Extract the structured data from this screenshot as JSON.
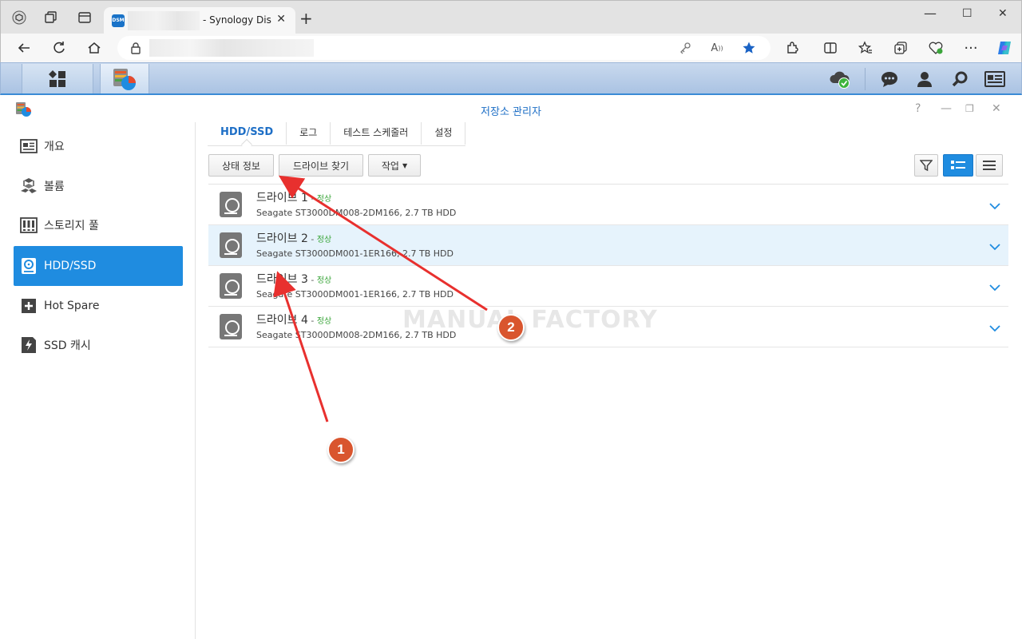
{
  "browser": {
    "tab_title": "- Synology DiskS",
    "tab_favicon": "DSM",
    "colors": {
      "accent": "#1f8ce0"
    }
  },
  "app": {
    "title": "저장소 관리자"
  },
  "sidebar": {
    "items": [
      {
        "label": "개요",
        "icon": "overview-icon"
      },
      {
        "label": "볼륨",
        "icon": "volume-icon"
      },
      {
        "label": "스토리지 풀",
        "icon": "storage-pool-icon"
      },
      {
        "label": "HDD/SSD",
        "icon": "hdd-icon",
        "active": true
      },
      {
        "label": "Hot Spare",
        "icon": "hot-spare-icon"
      },
      {
        "label": "SSD 캐시",
        "icon": "ssd-cache-icon"
      }
    ]
  },
  "tabs": [
    "HDD/SSD",
    "로그",
    "테스트 스케줄러",
    "설정"
  ],
  "toolbar": {
    "status_info": "상태 정보",
    "find_drive": "드라이브 찾기",
    "action": "작업"
  },
  "drives": [
    {
      "name": "드라이브 1",
      "sep": " - ",
      "status": "정상",
      "desc": "Seagate ST3000DM008-2DM166, 2.7 TB HDD"
    },
    {
      "name": "드라이브 2",
      "sep": " - ",
      "status": "정상",
      "desc": "Seagate ST3000DM001-1ER166, 2.7 TB HDD"
    },
    {
      "name": "드라이브 3",
      "sep": " - ",
      "status": "정상",
      "desc": "Seagate ST3000DM001-1ER166, 2.7 TB HDD"
    },
    {
      "name": "드라이브 4",
      "sep": " - ",
      "status": "정상",
      "desc": "Seagate ST3000DM008-2DM166, 2.7 TB HDD"
    }
  ],
  "watermark": "MANUAL FACTORY",
  "annotations": [
    "1",
    "2"
  ]
}
